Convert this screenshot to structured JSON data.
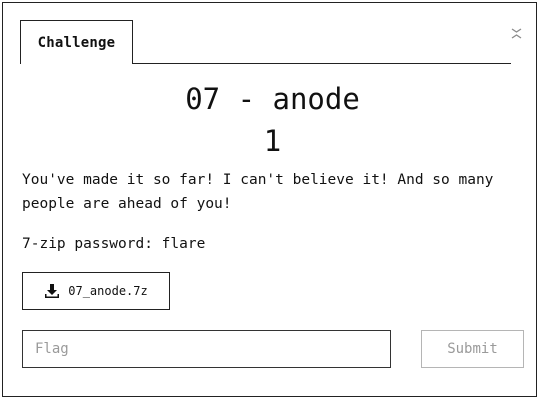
{
  "modal": {
    "tabs": [
      {
        "label": "Challenge"
      }
    ],
    "title": "07 - anode",
    "points": "1",
    "description": "You've made it so far! I can't believe it! And so many people are ahead of you!",
    "password_line": "7-zip password: flare",
    "download": {
      "filename": "07_anode.7z",
      "icon": "download-icon"
    },
    "flag": {
      "value": "",
      "placeholder": "Flag"
    },
    "submit_label": "Submit",
    "close_icon": "close-icon"
  }
}
